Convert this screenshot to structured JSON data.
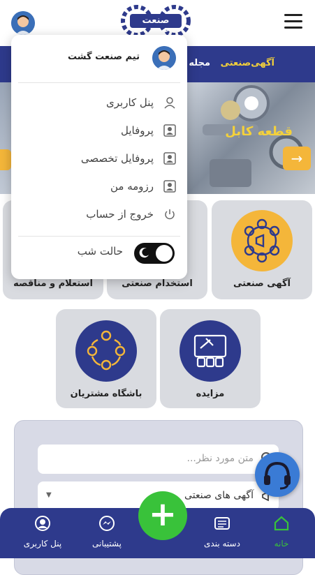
{
  "header": {
    "logo_text": "صنعت گشت",
    "hamburger_icon": "hamburger-menu-icon",
    "avatar_icon": "user-avatar-icon"
  },
  "navbar": {
    "items": [
      "آگهی‌صنعتی",
      "مجله"
    ],
    "active_color": "#f4d13a"
  },
  "banner": {
    "title": "قطعه کابل",
    "arrow_glyph": "→"
  },
  "categories": [
    {
      "label": "آگهی صنعتی",
      "icon": "megaphone-network-icon"
    },
    {
      "label": "استخدام صنعتی",
      "icon": "hiring-icon"
    },
    {
      "label": "استعلام و مناقصه",
      "icon": "tender-icon"
    },
    {
      "label": "مزایده",
      "icon": "auction-icon"
    },
    {
      "label": "باشگاه مشتریان",
      "icon": "customer-club-icon"
    }
  ],
  "search": {
    "placeholder": "متن مورد نظر...",
    "select_value": "آگهی های صنعتی"
  },
  "bottom_nav": [
    {
      "label": "خانه",
      "icon": "home-icon",
      "active": true
    },
    {
      "label": "دسته بندی",
      "icon": "category-icon"
    },
    {
      "label": "پشتیبانی",
      "icon": "messenger-icon"
    },
    {
      "label": "پنل کاربری",
      "icon": "user-circle-icon"
    }
  ],
  "add_button": "+",
  "menu": {
    "user_name": "تیم صنعت گشت",
    "items": [
      {
        "label": "پنل کاربری",
        "icon": "user-icon"
      },
      {
        "label": "پروفایل",
        "icon": "profile-icon"
      },
      {
        "label": "پروفایل تخصصی",
        "icon": "pro-profile-icon"
      },
      {
        "label": "رزومه من",
        "icon": "resume-icon"
      },
      {
        "label": "خروج از حساب",
        "icon": "power-icon"
      }
    ],
    "dark_mode_label": "حالت شب",
    "dark_mode_on": true
  },
  "colors": {
    "brand": "#2e3a8c",
    "accent": "#f4b63a",
    "fab": "#39c23a",
    "active_nav": "#39c23a"
  }
}
